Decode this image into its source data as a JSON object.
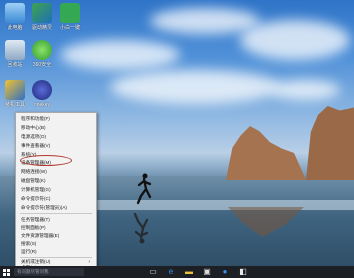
{
  "desktop_icons": [
    {
      "id": "pc",
      "label": "此电脑"
    },
    {
      "id": "app2",
      "label": "驱动精灵"
    },
    {
      "id": "app3",
      "label": "小白一键"
    },
    {
      "id": "recycle",
      "label": "回收站"
    },
    {
      "id": "app5",
      "label": "360安全"
    },
    {
      "id": "app6",
      "label": "装机工具"
    },
    {
      "id": "app7",
      "label": "onekey"
    }
  ],
  "context_menu": {
    "items": [
      "程序和功能(F)",
      "移动中心(B)",
      "电源选项(O)",
      "事件查看器(V)",
      "系统(Y)",
      "设备管理器(M)",
      "网络连接(W)",
      "磁盘管理(K)",
      "计算机管理(G)",
      "命令提示符(C)",
      "命令提示符(管理员)(A)",
      "任务管理器(T)",
      "控制面板(P)",
      "文件资源管理器(E)",
      "搜索(S)",
      "运行(R)",
      "关机或注销(U)",
      "桌面(D)"
    ],
    "highlighted": "设备管理器(M)"
  },
  "taskbar": {
    "search_placeholder": "有问题尽管问我"
  },
  "colors": {
    "highlight_ring": "#b0392e",
    "taskbar": "#1c1f24"
  }
}
